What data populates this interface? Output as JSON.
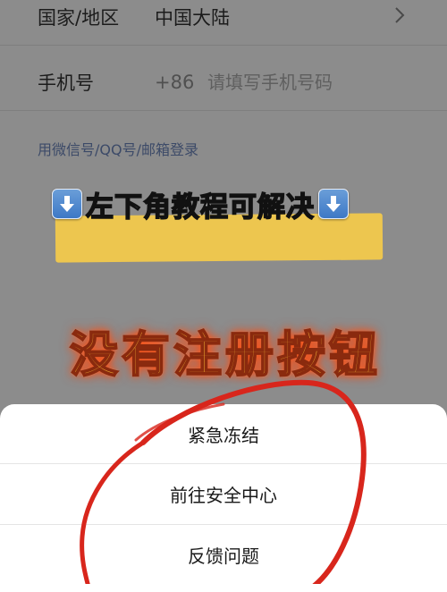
{
  "form": {
    "country": {
      "label": "国家/地区",
      "value": "中国大陆"
    },
    "phone": {
      "label": "手机号",
      "prefix": "+86",
      "placeholder": "请填写手机号码"
    },
    "alt_login": "用微信号/QQ号/邮箱登录"
  },
  "overlay": {
    "banner_text": "左下角教程可解决",
    "arrow_icon": "down-arrow-icon",
    "big_text": "没有注册按钮"
  },
  "action_sheet": {
    "items": [
      "紧急冻结",
      "前往安全中心",
      "反馈问题"
    ]
  },
  "colors": {
    "overlay": "#8c8c8c",
    "highlight": "#f2c94c",
    "big_text": "#f2b233",
    "circle": "#d8261c"
  }
}
